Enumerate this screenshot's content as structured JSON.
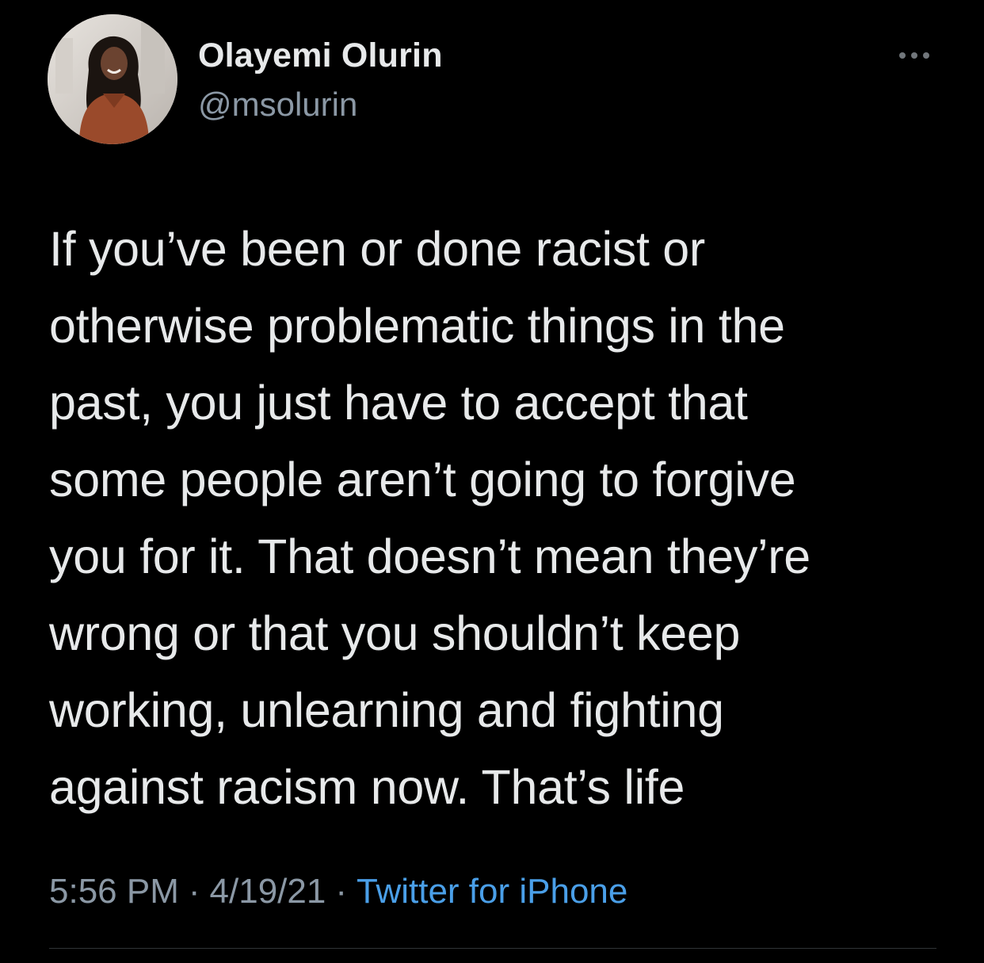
{
  "author": {
    "display_name": "Olayemi Olurin",
    "handle": "@msolurin",
    "avatar_icon": "profile-photo"
  },
  "tweet": {
    "text_lines": [
      "If you’ve been or done racist or",
      "otherwise problematic things in the",
      "past, you just have to accept that",
      "some people aren’t going to forgive",
      "you for it. That doesn’t mean they’re",
      "wrong or that you shouldn’t keep",
      "working, unlearning and fighting",
      "against racism now. That’s life"
    ]
  },
  "meta": {
    "time": "5:56 PM",
    "separator": "·",
    "date": "4/19/21",
    "source": "Twitter for iPhone"
  },
  "more_icon": "more-horizontal-icon",
  "colors": {
    "background": "#000000",
    "primary_text": "#e7e9ea",
    "secondary_text": "#8b98a5",
    "link": "#4a9fe8"
  }
}
